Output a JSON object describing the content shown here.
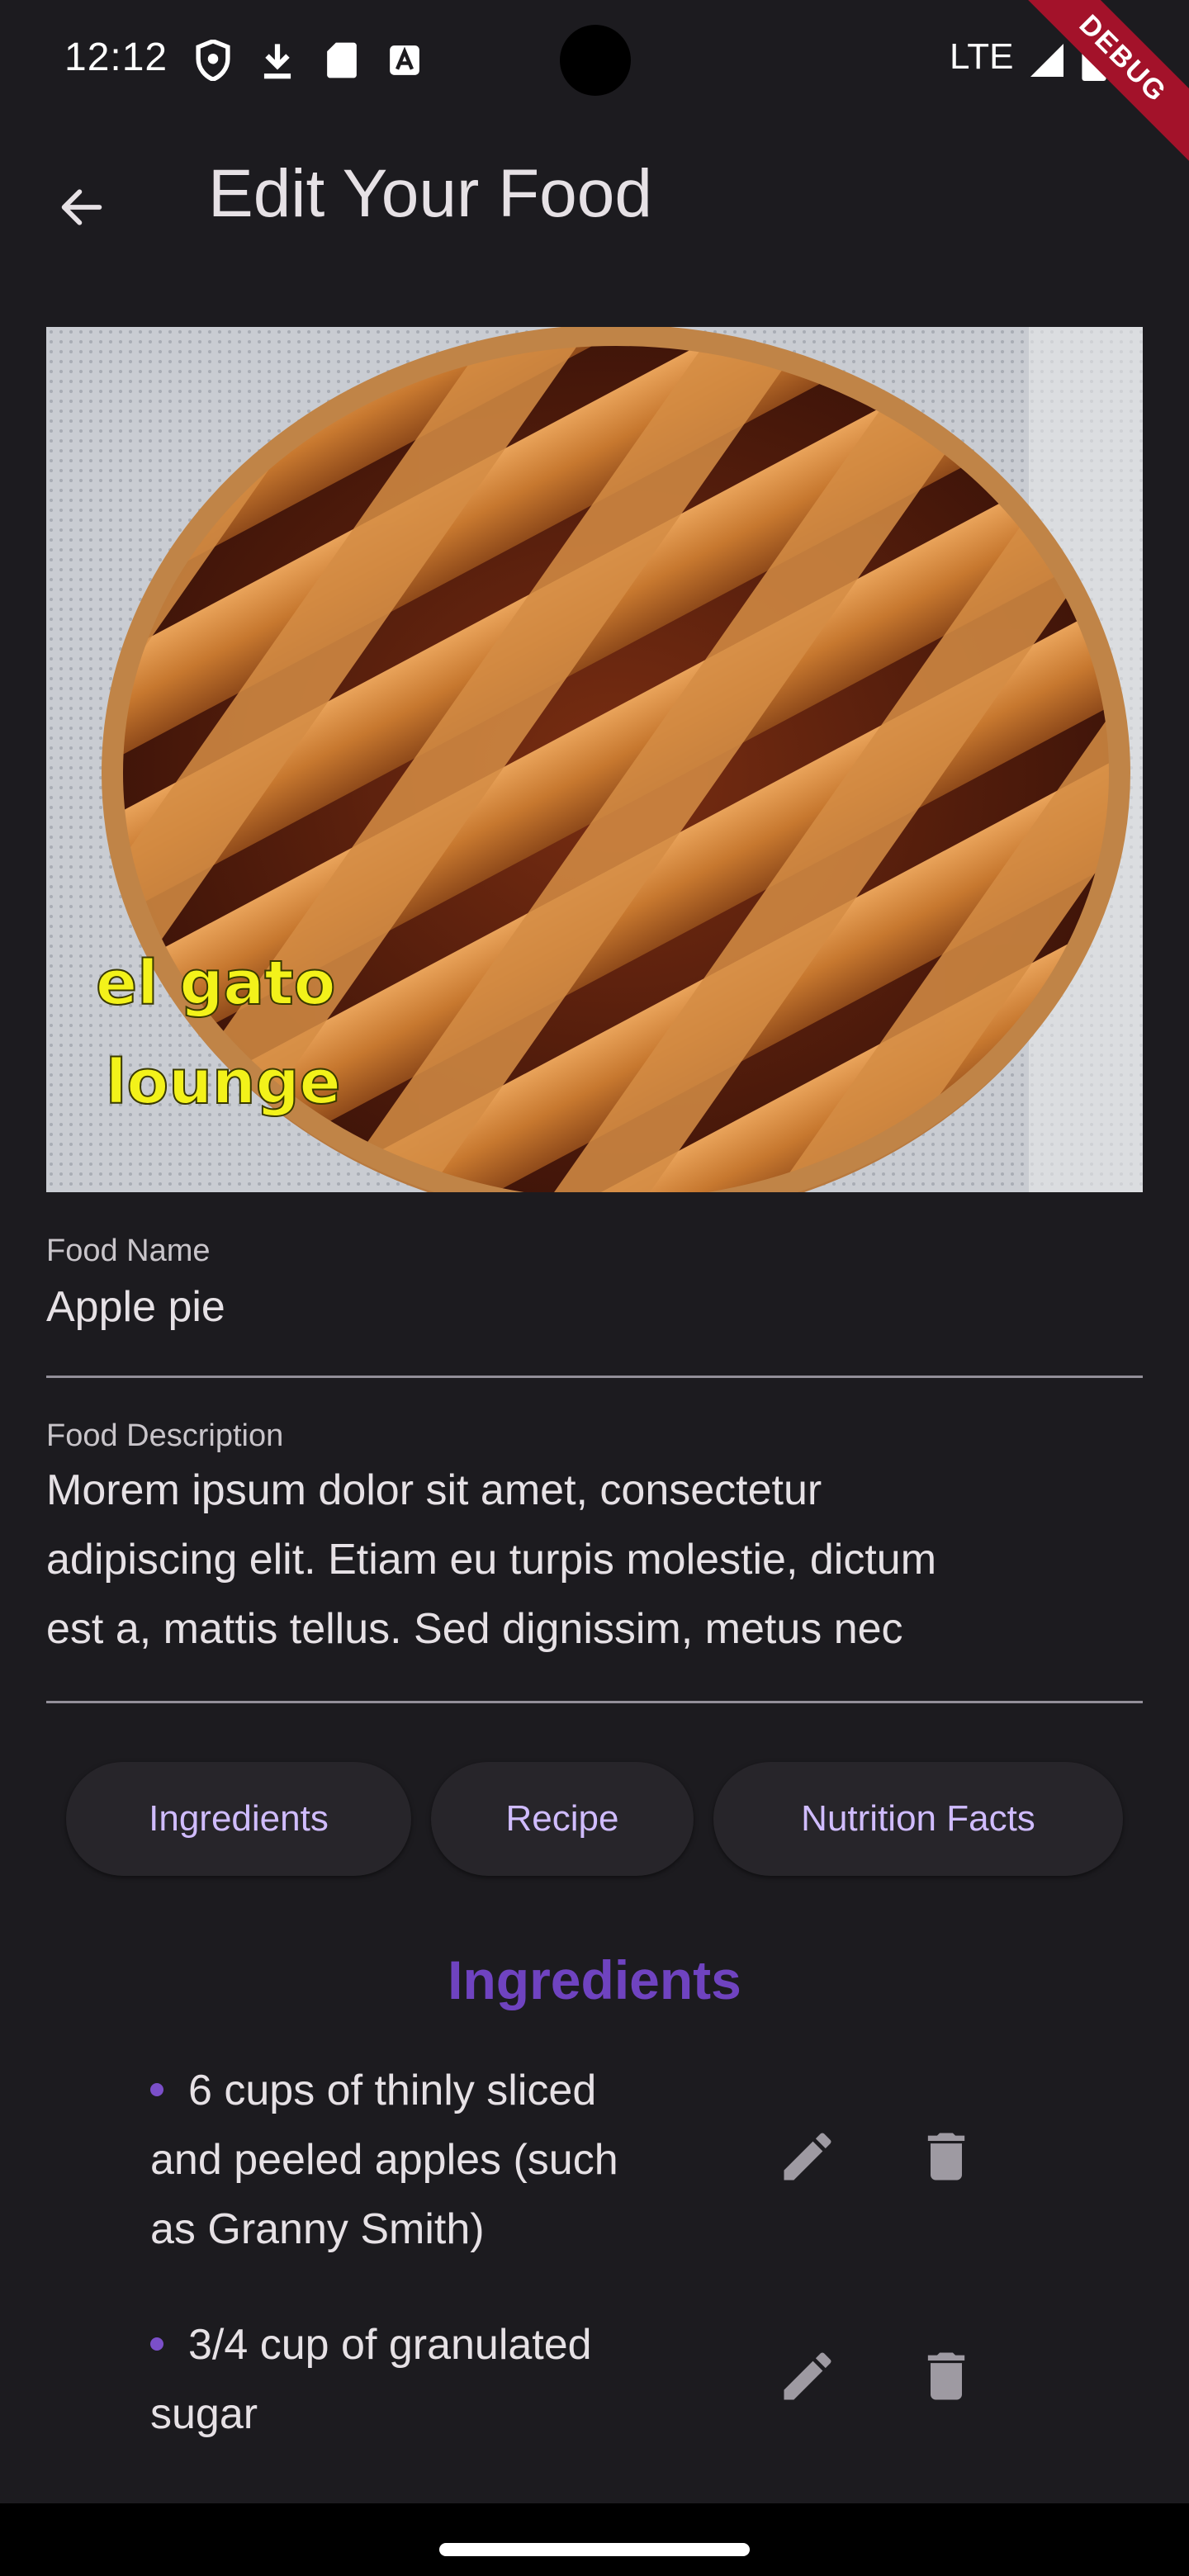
{
  "status_bar": {
    "time": "12:12",
    "network": "LTE"
  },
  "debug_banner": "DEBUG",
  "app_bar": {
    "title": "Edit Your Food",
    "back_icon": "arrow-back-icon"
  },
  "image": {
    "watermark_line1": "el gato",
    "watermark_line2": "lounge"
  },
  "fields": {
    "name": {
      "label": "Food Name",
      "value": "Apple pie"
    },
    "description": {
      "label": "Food Description",
      "lines": [
        "Morem ipsum dolor sit amet, consectetur",
        "adipiscing elit. Etiam eu turpis molestie, dictum",
        "est a, mattis tellus. Sed dignissim, metus nec"
      ]
    }
  },
  "tabs": [
    {
      "label": "Ingredients"
    },
    {
      "label": "Recipe"
    },
    {
      "label": "Nutrition Facts"
    }
  ],
  "section": {
    "title": "Ingredients"
  },
  "ingredients": [
    {
      "lines": [
        "6 cups of thinly sliced",
        "and peeled apples (such",
        "as Granny Smith)"
      ]
    },
    {
      "lines": [
        "3/4 cup of granulated",
        "sugar"
      ]
    }
  ],
  "colors": {
    "background": "#1c1b1f",
    "accent": "#d0bcff",
    "section_title": "#6f43c0",
    "tab_background": "#27252a"
  }
}
